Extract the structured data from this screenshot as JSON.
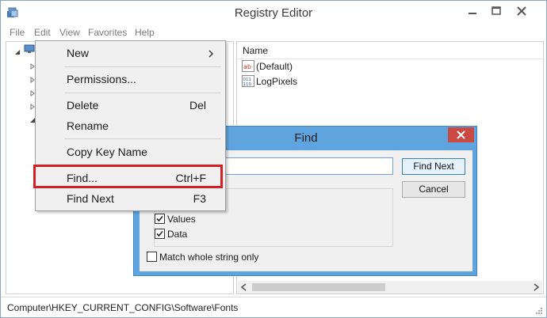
{
  "window": {
    "title": "Registry Editor",
    "icon": "registry-icon"
  },
  "menubar": {
    "file": "File",
    "edit": "Edit",
    "view": "View",
    "favorites": "Favorites",
    "help": "Help"
  },
  "right_pane": {
    "column_name": "Name",
    "values": [
      {
        "name": "(Default)",
        "icon": "string-value-icon"
      },
      {
        "name": "LogPixels",
        "icon": "binary-value-icon"
      }
    ]
  },
  "status_bar": {
    "path": "Computer\\HKEY_CURRENT_CONFIG\\Software\\Fonts"
  },
  "find_dialog": {
    "title": "Find",
    "find_next": "Find Next",
    "cancel": "Cancel",
    "search_value": "",
    "look_at": [
      {
        "label": "Values",
        "checked": true
      },
      {
        "label": "Data",
        "checked": true
      }
    ],
    "match_whole": {
      "label": "Match whole string only",
      "checked": false
    }
  },
  "context_menu": {
    "new": "New",
    "permissions": "Permissions...",
    "delete": "Delete",
    "delete_shortcut": "Del",
    "rename": "Rename",
    "copy_key_name": "Copy Key Name",
    "find": "Find...",
    "find_shortcut": "Ctrl+F",
    "find_next": "Find Next",
    "find_next_shortcut": "F3"
  },
  "colors": {
    "dialog_frame": "#5fa4de",
    "dialog_close": "#c74a43",
    "highlight": "#d11f27"
  }
}
